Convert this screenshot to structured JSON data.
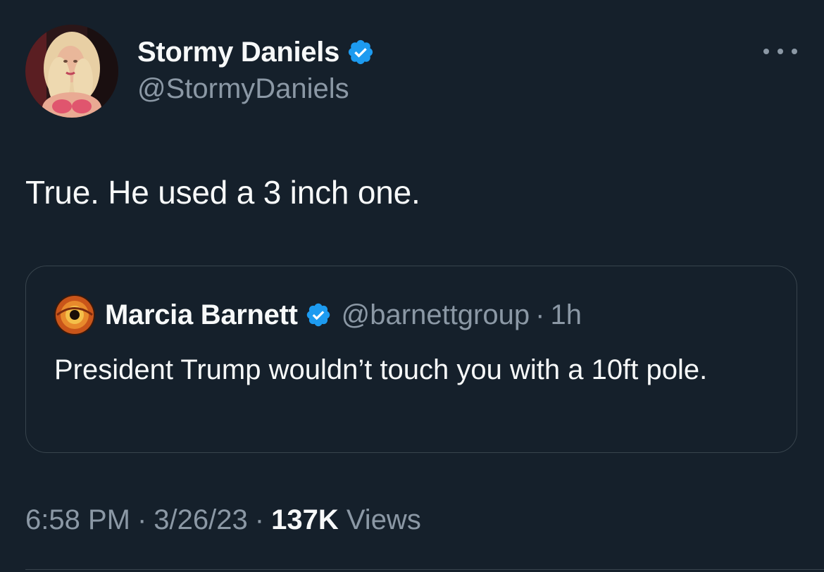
{
  "author": {
    "display_name": "Stormy Daniels",
    "handle": "@StormyDaniels",
    "verified": true,
    "verified_color": "#1d9bf0"
  },
  "tweet": {
    "text": "True. He used a 3 inch one."
  },
  "quoted_tweet": {
    "display_name": "Marcia Barnett",
    "handle": "@barnettgroup",
    "separator": "·",
    "time": "1h",
    "verified": true,
    "text": "President Trump wouldn’t touch you with a 10ft pole."
  },
  "meta": {
    "time": "6:58 PM",
    "separator": "·",
    "date": "3/26/23",
    "views_count": "137K",
    "views_label": "Views"
  },
  "icons": {
    "more": "more-horizontal-icon",
    "verified": "verified-badge-icon"
  },
  "colors": {
    "background": "#15202b",
    "text_primary": "#f7f9f9",
    "text_secondary": "#8b98a5",
    "border": "#38444d",
    "accent": "#1d9bf0"
  }
}
